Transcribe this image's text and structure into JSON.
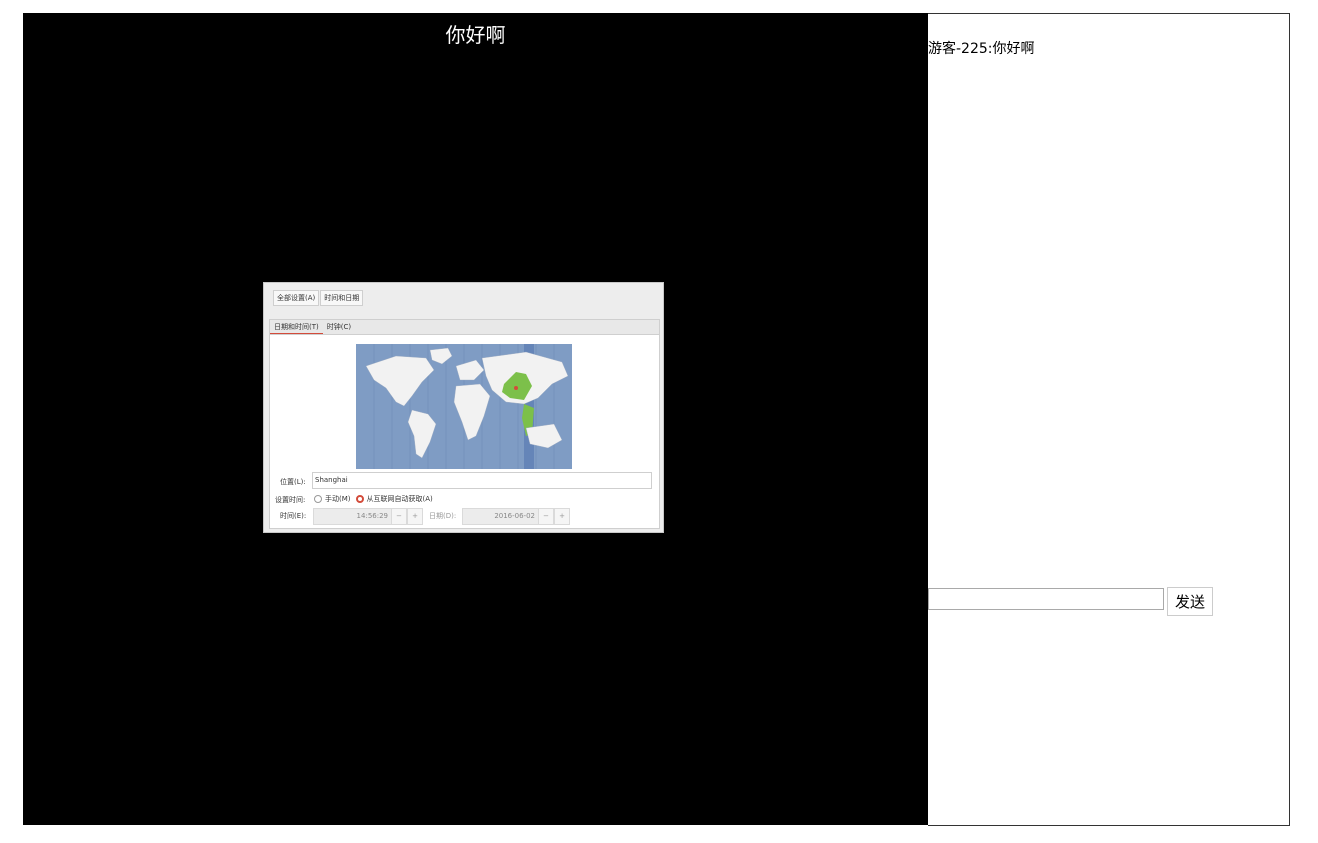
{
  "stage": {
    "title": "你好啊",
    "shared_screen": {
      "breadcrumbs": [
        "全部设置(A)",
        "时间和日期"
      ],
      "tabs": [
        "日期和时间(T)",
        "时钟(C)"
      ],
      "location_label": "位置(L):",
      "location_value": "Shanghai",
      "set_time_label": "设置时间:",
      "radio_manual": "手动(M)",
      "radio_auto": "从互联网自动获取(A)",
      "time_label": "时间(E):",
      "time_value": "14:56:29",
      "date_label": "日期(D):",
      "date_value": "2016-06-02",
      "minus": "−",
      "plus": "+"
    }
  },
  "chat": {
    "messages": [
      "游客-225:你好啊"
    ],
    "input_value": "",
    "send_label": "发送"
  },
  "colors": {
    "stage_bg": "#000000",
    "accent": "#d34b3a",
    "map_ocean": "#7f9cc4",
    "map_highlight": "#7cc04a"
  }
}
